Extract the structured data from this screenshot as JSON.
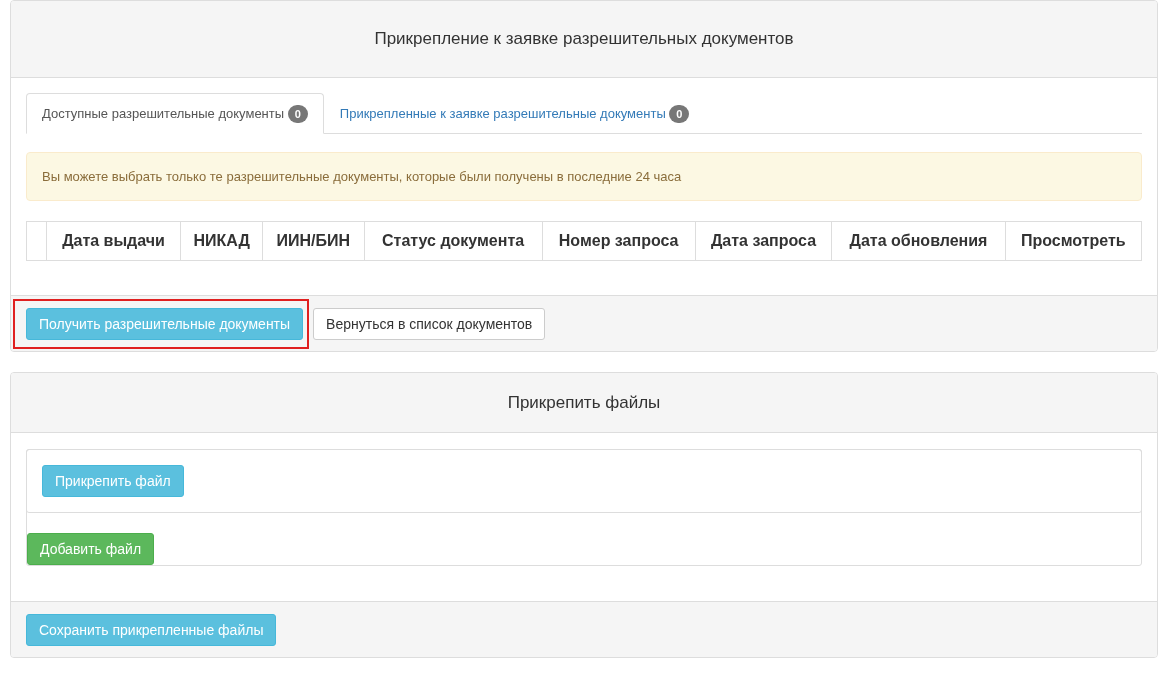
{
  "permits_panel": {
    "title": "Прикрепление к заявке разрешительных документов",
    "tabs": [
      {
        "label": "Доступные разрешительные документы",
        "count": "0",
        "selected": true
      },
      {
        "label": "Прикрепленные к заявке разрешительные документы",
        "count": "0",
        "selected": false
      }
    ],
    "alert": "Вы можете выбрать только те разрешительные документы, которые были получены в последние 24 часа",
    "table": {
      "columns": [
        "",
        "Дата выдачи",
        "НИКАД",
        "ИИН/БИН",
        "Статус документа",
        "Номер запроса",
        "Дата запроса",
        "Дата обновления",
        "Просмотреть"
      ]
    },
    "buttons": [
      {
        "label": "Получить разрешительные документы",
        "kind": "info",
        "highlighted": true
      },
      {
        "label": "Вернуться в список документов",
        "kind": "default",
        "highlighted": false
      }
    ]
  },
  "files_panel": {
    "title": "Прикрепить файлы",
    "attach_button": {
      "label": "Прикрепить файл",
      "kind": "info"
    },
    "add_button": {
      "label": "Добавить файл",
      "kind": "success"
    },
    "save_button": {
      "label": "Сохранить прикрепленные файлы",
      "kind": "info"
    }
  }
}
